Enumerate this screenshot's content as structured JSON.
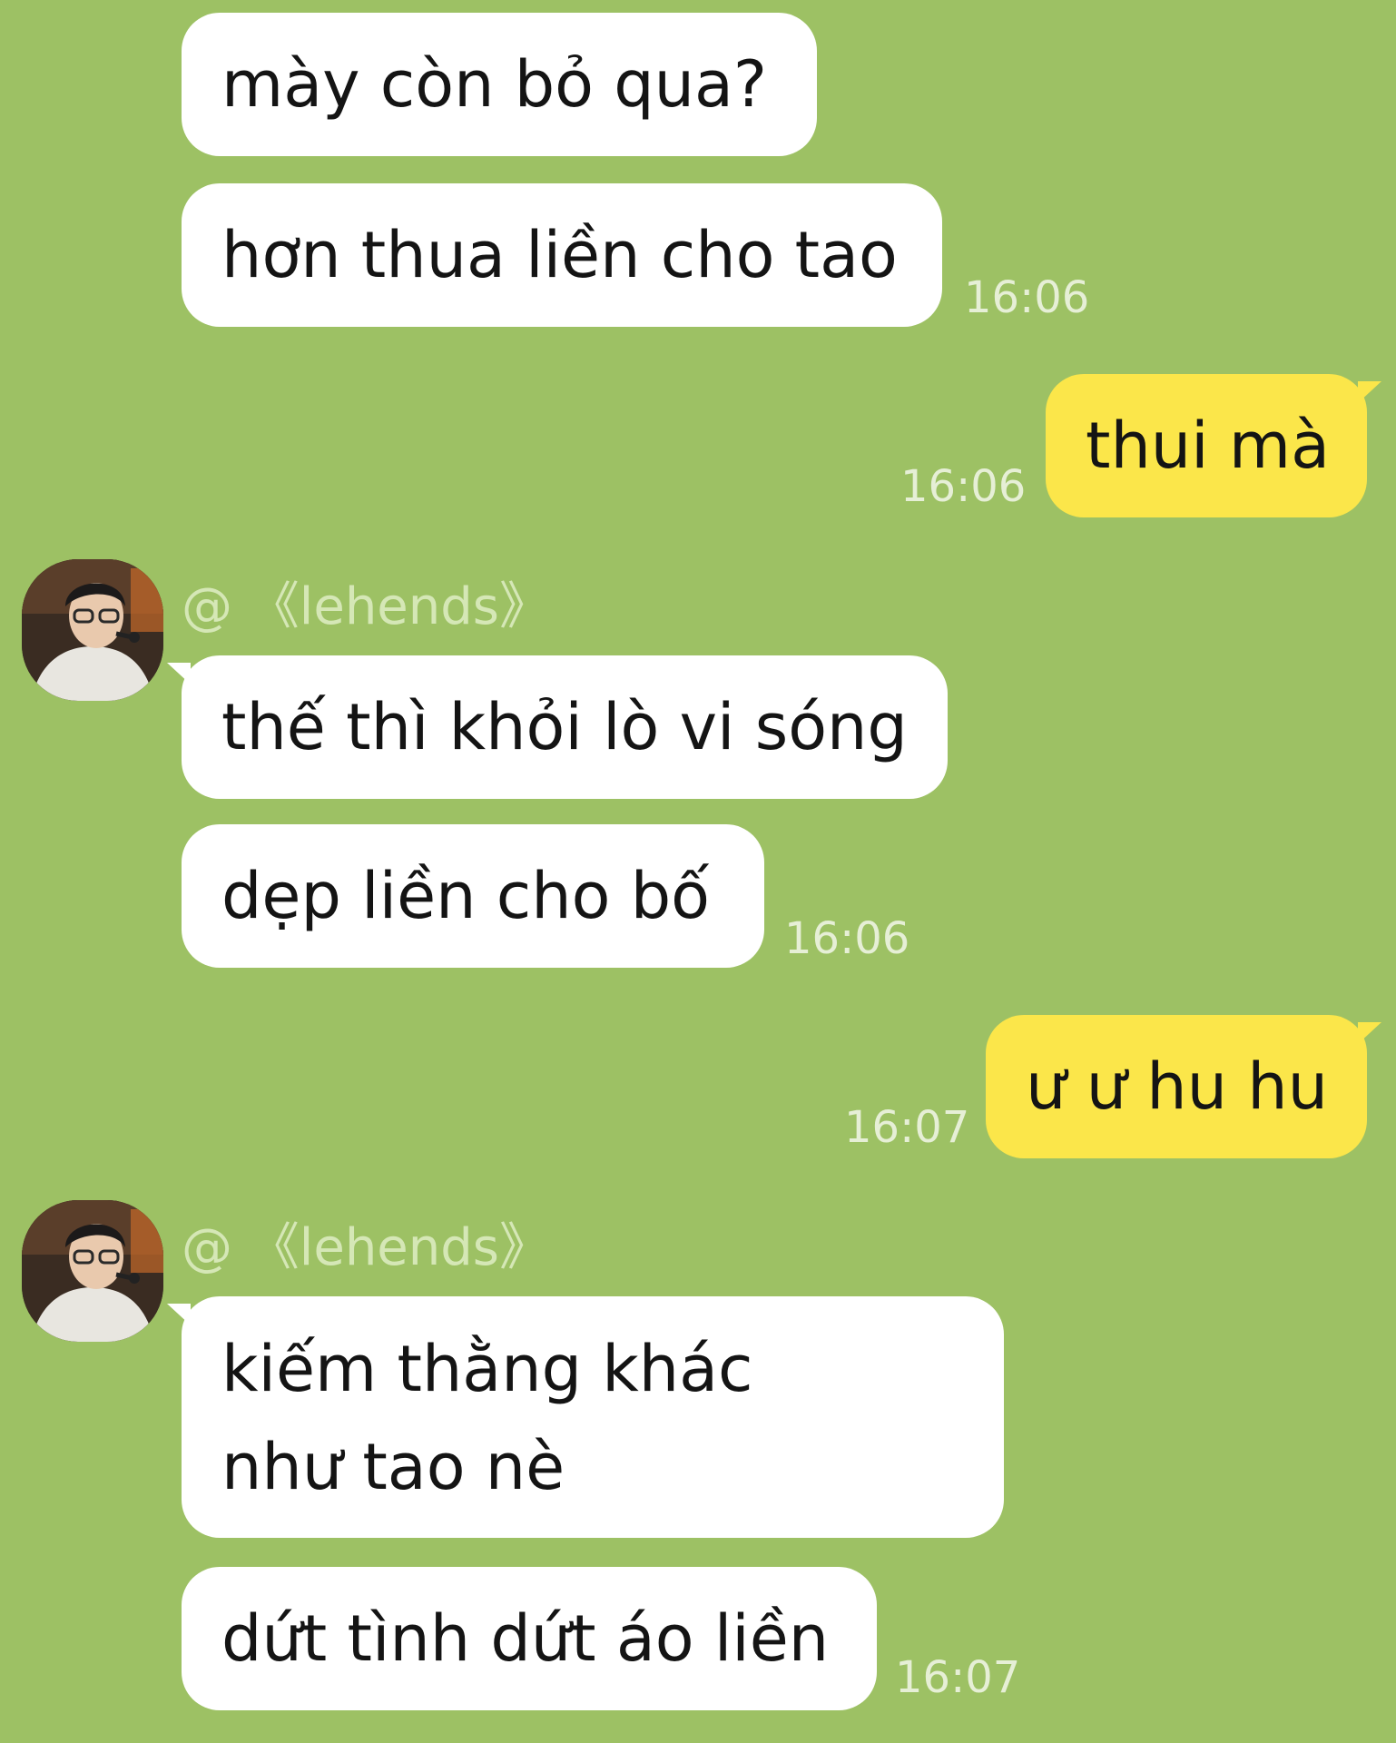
{
  "colors": {
    "background": "#9dc164",
    "incoming_bubble": "#ffffff",
    "outgoing_bubble": "#fbe64a",
    "timestamp": "#e6efd6",
    "sender_name": "#d5e7b6"
  },
  "messages": [
    {
      "text": "mày còn bỏ qua?"
    },
    {
      "text": "hơn thua liền cho tao",
      "time": "16:06"
    },
    {
      "text": "thui mà",
      "time": "16:06"
    },
    {
      "sender": "@ 《lehends》"
    },
    {
      "text": "thế thì khỏi lò vi sóng"
    },
    {
      "text": "dẹp liền cho bố",
      "time": "16:06"
    },
    {
      "text": "ư ư hu hu",
      "time": "16:07"
    },
    {
      "sender": "@ 《lehends》"
    },
    {
      "text": "kiếm thằng khác như tao nè"
    },
    {
      "text": "dứt tình dứt áo liền",
      "time": "16:07"
    }
  ],
  "avatar_icon": "user-avatar-photo"
}
